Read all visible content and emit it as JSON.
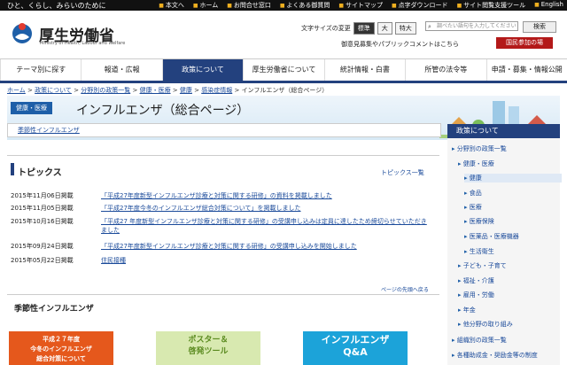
{
  "topbar": {
    "tagline": "ひと、くらし、みらいのために",
    "links": [
      "本文へ",
      "ホーム",
      "お問合せ窓口",
      "よくある御質問",
      "サイトマップ",
      "点字ダウンロード",
      "サイト閲覧支援ツール",
      "English"
    ]
  },
  "header": {
    "logo_jp": "厚生労働省",
    "logo_en": "Ministry of Health, Labour and Welfare",
    "text_size_label": "文字サイズの変更",
    "text_size_options": [
      "標準",
      "大",
      "特大"
    ],
    "search_placeholder": "調べたい語句を入力してください",
    "search_button": "検索",
    "opinion_link": "御意見募集やパブリックコメントはこちら",
    "guide_button": "国民参加の場"
  },
  "nav": [
    "テーマ別に探す",
    "報道・広報",
    "政策について",
    "厚生労働省について",
    "統計情報・白書",
    "所管の法令等",
    "申請・募集・情報公開"
  ],
  "breadcrumb": [
    "ホーム",
    "政策について",
    "分野別の政策一覧",
    "健康・医療",
    "健康",
    "感染症情報",
    "インフルエンザ（総合ページ）"
  ],
  "hero": {
    "badge": "健康・医療",
    "title": "インフルエンザ（総合ページ）"
  },
  "seasonal_link": "季節性インフルエンザ",
  "topics": {
    "heading": "トピックス",
    "all_link": "トピックス一覧",
    "items": [
      {
        "date": "2015年11月06日掲載",
        "title": "「平成27年度新型インフルエンザ診療と対策に関する研修」の資料を掲載しました"
      },
      {
        "date": "2015年11月05日掲載",
        "title": "「平成27年度今冬のインフルエンザ総合対策について」を掲載しました"
      },
      {
        "date": "2015年10月16日掲載",
        "title": "「平成27 年度新型インフルエンザ診療と対策に関する研修」の受講申し込みは定員に達したため締切らせていただきました"
      },
      {
        "date": "2015年09月24日掲載",
        "title": "「平成27年度新型インフルエンザ診療と対策に関する研修」の受講申し込みを開始しました"
      },
      {
        "date": "2015年05月22日掲載",
        "title": "住民接種"
      }
    ],
    "pagetop": "ページの先頭へ戻る"
  },
  "season_heading": "季節性インフルエンザ",
  "banners": [
    {
      "l1": "平成２７年度",
      "l2": "今冬のインフルエンザ",
      "l3": "総合対策について"
    },
    {
      "l1": "ポスター＆",
      "l2": "啓発ツール"
    },
    {
      "l1": "インフルエンザ",
      "l2": "Q&A"
    }
  ],
  "sidebar": {
    "heading": "政策について",
    "items": [
      "分野別の政策一覧",
      "健康・医療",
      "健康",
      "食品",
      "医療",
      "医療保険",
      "医薬品・医療機器",
      "生活衛生",
      "子ども・子育て",
      "福祉・介護",
      "雇用・労働",
      "年金",
      "他分野の取り組み",
      "組織別の政策一覧",
      "各種助成金・奨励金等の制度"
    ]
  }
}
